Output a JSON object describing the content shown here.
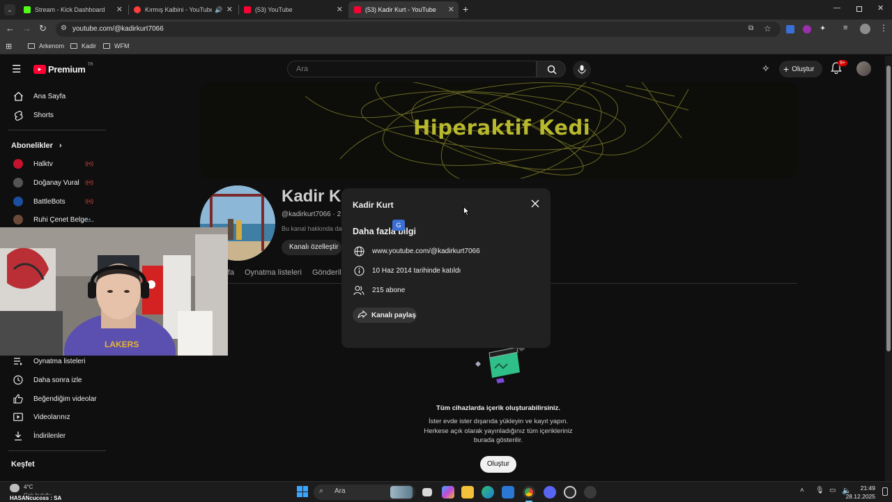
{
  "browser": {
    "tabs": [
      {
        "title": "Stream - Kick Dashboard",
        "color": "#53fc18"
      },
      {
        "title": "Kırmış Kalbini - YouTube M",
        "color": "#ff3d3d"
      },
      {
        "title": "(53) YouTube",
        "color": "#ff0033"
      },
      {
        "title": "(53) Kadir Kurt - YouTube",
        "color": "#ff0033"
      }
    ],
    "url": "youtube.com/@kadirkurt7066",
    "bookmarks": [
      "Arkenom",
      "Kadir",
      "WFM"
    ]
  },
  "youtube": {
    "logo": "Premium",
    "logo_country": "TR",
    "search_placeholder": "Ara",
    "create_label": "Oluştur",
    "notif_badge": "9+"
  },
  "sidebar": {
    "top_items": [
      {
        "label": "Ana Sayfa",
        "icon": "home-icon"
      },
      {
        "label": "Shorts",
        "icon": "shorts-icon"
      }
    ],
    "subscriptions_title": "Abonelikler",
    "subscriptions": [
      {
        "label": "Halktv",
        "avatar_color": "#c4122f",
        "live": true
      },
      {
        "label": "Doğanay Vural",
        "avatar_color": "#555555",
        "live": true
      },
      {
        "label": "BattleBots",
        "avatar_color": "#1b4fa0",
        "live": true
      },
      {
        "label": "Ruhi Çenet Belge...",
        "avatar_color": "#6b4a3a",
        "live": false
      }
    ],
    "you_items": [
      {
        "label": "Oynatma listeleri",
        "icon": "playlist-icon"
      },
      {
        "label": "Daha sonra izle",
        "icon": "clock-icon"
      },
      {
        "label": "Beğendiğim videolar",
        "icon": "thumbs-up-icon"
      },
      {
        "label": "Videolarınız",
        "icon": "video-icon"
      },
      {
        "label": "İndirilenler",
        "icon": "download-icon"
      }
    ],
    "explore_title": "Keşfet"
  },
  "channel": {
    "banner_text": "Hiperaktif Kedi",
    "name": "Kadir Kurt",
    "handle": "@kadirkurt7066 · 21",
    "about": "Bu kanal hakkında daha fazla bilgi",
    "customize_label": "Kanalı özelleştir",
    "tabs": [
      "Ana Sayfa",
      "Oynatma listeleri",
      "Gönderiler"
    ]
  },
  "empty_state": {
    "title": "Tüm cihazlarda içerik oluşturabilirsiniz.",
    "description_lines": [
      "İster evde ister dışarıda yükleyin ve kayıt yapın.",
      "Herkese açık olarak yayınladığınız tüm içerikleriniz",
      "burada gösterilir."
    ],
    "button": "Oluştur"
  },
  "dialog": {
    "title": "Kadir Kurt",
    "section_title": "Daha fazla bilgi",
    "link": "www.youtube.com/@kadirkurt7066",
    "joined": "10 Haz 2014 tarihinde katıldı",
    "subscribers": "215 abone",
    "share_label": "Kanalı paylaş"
  },
  "taskbar": {
    "weather_temp": "4°C",
    "weather_desc": "Çok bulutlu",
    "search": "Ara",
    "time": "21:49",
    "date": "28.12.2025",
    "overlay_text": "HASANcucoss : SA"
  },
  "colors": {
    "background": "#0f0f0f",
    "dialog": "#212121",
    "youtube_red": "#ff0033",
    "banner_text": "#b8b82e"
  }
}
